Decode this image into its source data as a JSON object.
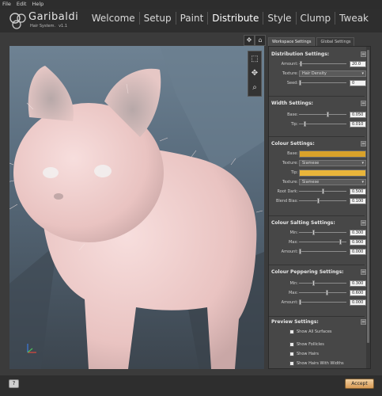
{
  "menu": [
    "File",
    "Edit",
    "Help"
  ],
  "brand": {
    "name": "Garibaldi",
    "subtitle": "Hair System.",
    "version": "v1.1"
  },
  "tabs": [
    {
      "label": "Welcome",
      "active": false
    },
    {
      "label": "Setup",
      "active": false
    },
    {
      "label": "Paint",
      "active": false
    },
    {
      "label": "Distribute",
      "active": true
    },
    {
      "label": "Style",
      "active": false
    },
    {
      "label": "Clump",
      "active": false
    },
    {
      "label": "Tweak",
      "active": false
    }
  ],
  "settings_tabs": {
    "workspace": "Workspace Settings",
    "global": "Global Settings"
  },
  "distribution": {
    "title": "Distribution Settings:",
    "amount_label": "Amount:",
    "amount_value": "20.0",
    "amount_fraction": 0.02,
    "texture_label": "Texture:",
    "texture_value": "Hair Density",
    "seed_label": "Seed:",
    "seed_value": "0"
  },
  "width": {
    "title": "Width Settings:",
    "base_label": "Base:",
    "base_value": "0.050",
    "base_fraction": 0.62,
    "tip_label": "Tip:",
    "tip_value": "0.010",
    "tip_fraction": 0.1
  },
  "colour": {
    "title": "Colour Settings:",
    "base_label": "Base:",
    "base_color": "#d9a22a",
    "texture1_label": "Texture:",
    "texture1_value": "Siamese",
    "tip_label": "Tip:",
    "tip_color": "#e9b53a",
    "texture2_label": "Texture:",
    "texture2_value": "Siamese",
    "root_dark_label": "Root Dark:",
    "root_dark_value": "0.500",
    "root_dark_fraction": 0.5,
    "blend_bias_label": "Blend Bias:",
    "blend_bias_value": "0.100",
    "blend_bias_fraction": 0.4
  },
  "salting": {
    "title": "Colour Salting Settings:",
    "min_label": "Min:",
    "min_value": "0.300",
    "min_fraction": 0.3,
    "max_label": "Max:",
    "max_value": "0.900",
    "max_fraction": 0.9,
    "amount_label": "Amount:",
    "amount_value": "0.000",
    "amount_fraction": 0.0
  },
  "peppering": {
    "title": "Colour Peppering Settings:",
    "min_label": "Min:",
    "min_value": "0.300",
    "min_fraction": 0.3,
    "max_label": "Max:",
    "max_value": "0.600",
    "max_fraction": 0.6,
    "amount_label": "Amount:",
    "amount_value": "0.000",
    "amount_fraction": 0.0
  },
  "preview": {
    "title": "Preview Settings:",
    "show_all_surfaces": "Show All Surfaces",
    "show_follicles": "Show Follicles",
    "show_hairs": "Show Hairs",
    "show_hairs_with_widths": "Show Hairs With Widths"
  },
  "buttons": {
    "help": "?",
    "accept": "Accept",
    "collapse": "−"
  },
  "colors": {
    "accept": "#d89b55",
    "panel": "#474747",
    "background": "#3b3b3b"
  }
}
